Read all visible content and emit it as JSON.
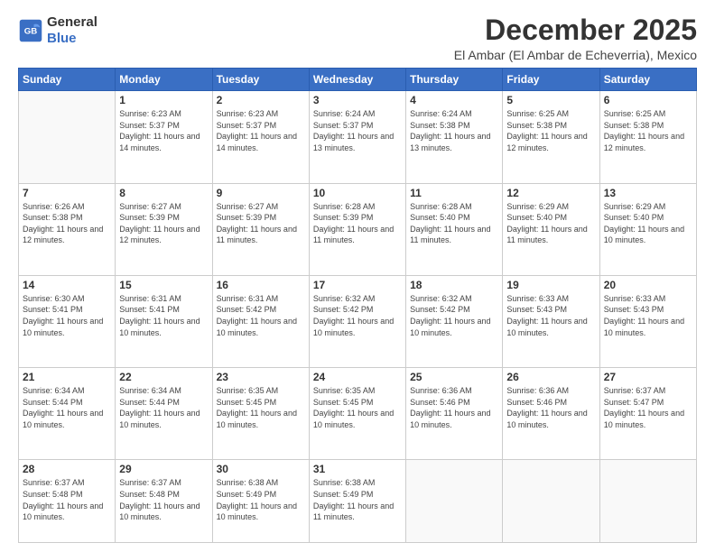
{
  "logo": {
    "general": "General",
    "blue": "Blue"
  },
  "title": "December 2025",
  "location": "El Ambar (El Ambar de Echeverria), Mexico",
  "days_of_week": [
    "Sunday",
    "Monday",
    "Tuesday",
    "Wednesday",
    "Thursday",
    "Friday",
    "Saturday"
  ],
  "weeks": [
    [
      {
        "day": "",
        "sunrise": "",
        "sunset": "",
        "daylight": ""
      },
      {
        "day": "1",
        "sunrise": "Sunrise: 6:23 AM",
        "sunset": "Sunset: 5:37 PM",
        "daylight": "Daylight: 11 hours and 14 minutes."
      },
      {
        "day": "2",
        "sunrise": "Sunrise: 6:23 AM",
        "sunset": "Sunset: 5:37 PM",
        "daylight": "Daylight: 11 hours and 14 minutes."
      },
      {
        "day": "3",
        "sunrise": "Sunrise: 6:24 AM",
        "sunset": "Sunset: 5:37 PM",
        "daylight": "Daylight: 11 hours and 13 minutes."
      },
      {
        "day": "4",
        "sunrise": "Sunrise: 6:24 AM",
        "sunset": "Sunset: 5:38 PM",
        "daylight": "Daylight: 11 hours and 13 minutes."
      },
      {
        "day": "5",
        "sunrise": "Sunrise: 6:25 AM",
        "sunset": "Sunset: 5:38 PM",
        "daylight": "Daylight: 11 hours and 12 minutes."
      },
      {
        "day": "6",
        "sunrise": "Sunrise: 6:25 AM",
        "sunset": "Sunset: 5:38 PM",
        "daylight": "Daylight: 11 hours and 12 minutes."
      }
    ],
    [
      {
        "day": "7",
        "sunrise": "Sunrise: 6:26 AM",
        "sunset": "Sunset: 5:38 PM",
        "daylight": "Daylight: 11 hours and 12 minutes."
      },
      {
        "day": "8",
        "sunrise": "Sunrise: 6:27 AM",
        "sunset": "Sunset: 5:39 PM",
        "daylight": "Daylight: 11 hours and 12 minutes."
      },
      {
        "day": "9",
        "sunrise": "Sunrise: 6:27 AM",
        "sunset": "Sunset: 5:39 PM",
        "daylight": "Daylight: 11 hours and 11 minutes."
      },
      {
        "day": "10",
        "sunrise": "Sunrise: 6:28 AM",
        "sunset": "Sunset: 5:39 PM",
        "daylight": "Daylight: 11 hours and 11 minutes."
      },
      {
        "day": "11",
        "sunrise": "Sunrise: 6:28 AM",
        "sunset": "Sunset: 5:40 PM",
        "daylight": "Daylight: 11 hours and 11 minutes."
      },
      {
        "day": "12",
        "sunrise": "Sunrise: 6:29 AM",
        "sunset": "Sunset: 5:40 PM",
        "daylight": "Daylight: 11 hours and 11 minutes."
      },
      {
        "day": "13",
        "sunrise": "Sunrise: 6:29 AM",
        "sunset": "Sunset: 5:40 PM",
        "daylight": "Daylight: 11 hours and 10 minutes."
      }
    ],
    [
      {
        "day": "14",
        "sunrise": "Sunrise: 6:30 AM",
        "sunset": "Sunset: 5:41 PM",
        "daylight": "Daylight: 11 hours and 10 minutes."
      },
      {
        "day": "15",
        "sunrise": "Sunrise: 6:31 AM",
        "sunset": "Sunset: 5:41 PM",
        "daylight": "Daylight: 11 hours and 10 minutes."
      },
      {
        "day": "16",
        "sunrise": "Sunrise: 6:31 AM",
        "sunset": "Sunset: 5:42 PM",
        "daylight": "Daylight: 11 hours and 10 minutes."
      },
      {
        "day": "17",
        "sunrise": "Sunrise: 6:32 AM",
        "sunset": "Sunset: 5:42 PM",
        "daylight": "Daylight: 11 hours and 10 minutes."
      },
      {
        "day": "18",
        "sunrise": "Sunrise: 6:32 AM",
        "sunset": "Sunset: 5:42 PM",
        "daylight": "Daylight: 11 hours and 10 minutes."
      },
      {
        "day": "19",
        "sunrise": "Sunrise: 6:33 AM",
        "sunset": "Sunset: 5:43 PM",
        "daylight": "Daylight: 11 hours and 10 minutes."
      },
      {
        "day": "20",
        "sunrise": "Sunrise: 6:33 AM",
        "sunset": "Sunset: 5:43 PM",
        "daylight": "Daylight: 11 hours and 10 minutes."
      }
    ],
    [
      {
        "day": "21",
        "sunrise": "Sunrise: 6:34 AM",
        "sunset": "Sunset: 5:44 PM",
        "daylight": "Daylight: 11 hours and 10 minutes."
      },
      {
        "day": "22",
        "sunrise": "Sunrise: 6:34 AM",
        "sunset": "Sunset: 5:44 PM",
        "daylight": "Daylight: 11 hours and 10 minutes."
      },
      {
        "day": "23",
        "sunrise": "Sunrise: 6:35 AM",
        "sunset": "Sunset: 5:45 PM",
        "daylight": "Daylight: 11 hours and 10 minutes."
      },
      {
        "day": "24",
        "sunrise": "Sunrise: 6:35 AM",
        "sunset": "Sunset: 5:45 PM",
        "daylight": "Daylight: 11 hours and 10 minutes."
      },
      {
        "day": "25",
        "sunrise": "Sunrise: 6:36 AM",
        "sunset": "Sunset: 5:46 PM",
        "daylight": "Daylight: 11 hours and 10 minutes."
      },
      {
        "day": "26",
        "sunrise": "Sunrise: 6:36 AM",
        "sunset": "Sunset: 5:46 PM",
        "daylight": "Daylight: 11 hours and 10 minutes."
      },
      {
        "day": "27",
        "sunrise": "Sunrise: 6:37 AM",
        "sunset": "Sunset: 5:47 PM",
        "daylight": "Daylight: 11 hours and 10 minutes."
      }
    ],
    [
      {
        "day": "28",
        "sunrise": "Sunrise: 6:37 AM",
        "sunset": "Sunset: 5:48 PM",
        "daylight": "Daylight: 11 hours and 10 minutes."
      },
      {
        "day": "29",
        "sunrise": "Sunrise: 6:37 AM",
        "sunset": "Sunset: 5:48 PM",
        "daylight": "Daylight: 11 hours and 10 minutes."
      },
      {
        "day": "30",
        "sunrise": "Sunrise: 6:38 AM",
        "sunset": "Sunset: 5:49 PM",
        "daylight": "Daylight: 11 hours and 10 minutes."
      },
      {
        "day": "31",
        "sunrise": "Sunrise: 6:38 AM",
        "sunset": "Sunset: 5:49 PM",
        "daylight": "Daylight: 11 hours and 11 minutes."
      },
      {
        "day": "",
        "sunrise": "",
        "sunset": "",
        "daylight": ""
      },
      {
        "day": "",
        "sunrise": "",
        "sunset": "",
        "daylight": ""
      },
      {
        "day": "",
        "sunrise": "",
        "sunset": "",
        "daylight": ""
      }
    ]
  ]
}
